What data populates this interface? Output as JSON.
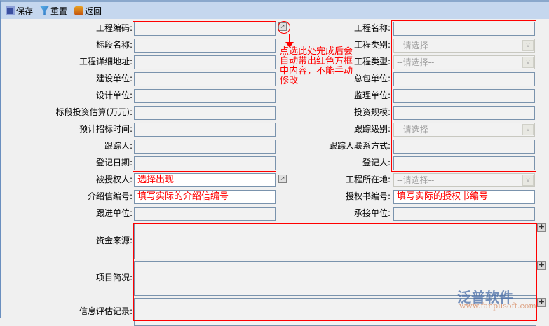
{
  "toolbar": {
    "save": "保存",
    "reset": "重置",
    "back": "返回"
  },
  "left_rows": [
    {
      "label": "工程编码:",
      "type": "input"
    },
    {
      "label": "标段名称:",
      "type": "input"
    },
    {
      "label": "工程详细地址:",
      "type": "input"
    },
    {
      "label": "建设单位:",
      "type": "input"
    },
    {
      "label": "设计单位:",
      "type": "input"
    },
    {
      "label": "标段投资估算(万元):",
      "type": "input"
    },
    {
      "label": "预计招标时间:",
      "type": "input"
    },
    {
      "label": "跟踪人:",
      "type": "input"
    },
    {
      "label": "登记日期:",
      "type": "input"
    },
    {
      "label": "被授权人:",
      "type": "input",
      "value": "选择出现",
      "white": true
    },
    {
      "label": "介绍信编号:",
      "type": "input",
      "value": "填写实际的介绍信编号",
      "white": true
    },
    {
      "label": "跟进单位:",
      "type": "input"
    }
  ],
  "right_rows": [
    {
      "label": "工程名称:",
      "type": "input"
    },
    {
      "label": "工程类别:",
      "type": "select",
      "value": "--请选择--"
    },
    {
      "label": "工程类型:",
      "type": "select",
      "value": "--请选择--"
    },
    {
      "label": "总包单位:",
      "type": "input"
    },
    {
      "label": "监理单位:",
      "type": "input"
    },
    {
      "label": "投资规模:",
      "type": "input"
    },
    {
      "label": "跟踪级别:",
      "type": "select",
      "value": "--请选择--"
    },
    {
      "label": "跟踪人联系方式:",
      "type": "input"
    },
    {
      "label": "登记人:",
      "type": "input"
    },
    {
      "label": "工程所在地:",
      "type": "select",
      "value": "--请选择--"
    },
    {
      "label": "授权书编号:",
      "type": "input",
      "value": "填写实际的授权书编号",
      "white": true
    },
    {
      "label": "承接单位:",
      "type": "input"
    }
  ],
  "textareas": [
    {
      "label": "资金来源:"
    },
    {
      "label": "项目简况:"
    },
    {
      "label": "信息评估记录:"
    }
  ],
  "annotation": "点选此处完成后会自动带出红色方框中内容，不能手动修改",
  "logo": {
    "name": "泛普软件",
    "url": "www.fanpusoft.com"
  }
}
